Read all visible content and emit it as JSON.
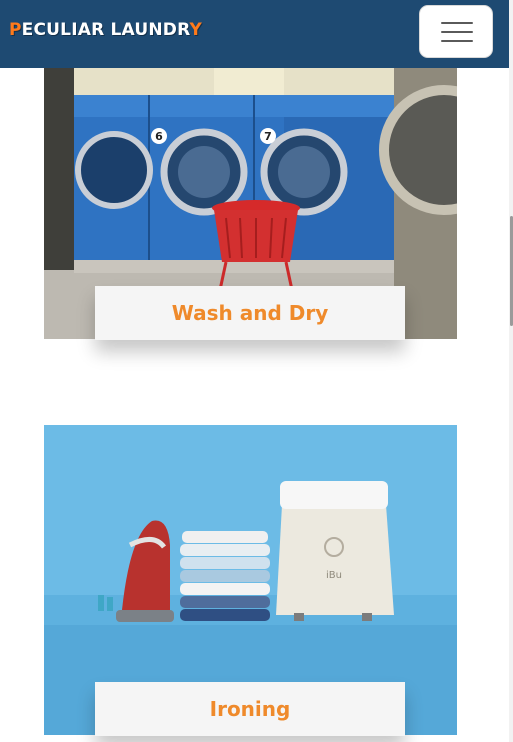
{
  "header": {
    "brand_first": "P",
    "brand_middle": "ECULIAR LAUNDR",
    "brand_last": "Y",
    "menu_toggle": "Toggle navigation"
  },
  "services": [
    {
      "title": "Wash and Dry",
      "image": "laundromat-washing-machines"
    },
    {
      "title": "Ironing",
      "image": "iron-and-folded-clothes"
    }
  ],
  "colors": {
    "navbar": "#1e4a72",
    "accent": "#ff7a1a",
    "label_text": "#ef8a2b",
    "label_bg": "#f5f5f5"
  },
  "icons": {
    "menu": "hamburger-menu-icon"
  }
}
